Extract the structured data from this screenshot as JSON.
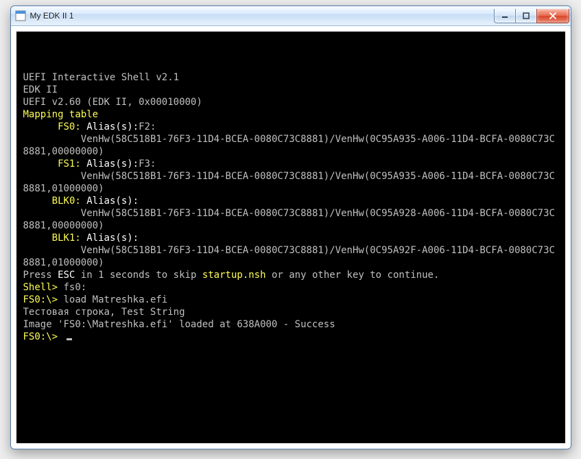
{
  "window": {
    "title": "My EDK II 1"
  },
  "shell": {
    "banner1": "UEFI Interactive Shell v2.1",
    "banner2": "EDK II",
    "banner3": "UEFI v2.60 (EDK II, 0x00010000)",
    "mapping_table": "Mapping table",
    "fs0_label": "FS0:",
    "fs0_alias": " Alias(s):",
    "fs0_alias_val": "F2:",
    "fs0_path": "          VenHw(58C518B1-76F3-11D4-BCEA-0080C73C8881)/VenHw(0C95A935-A006-11D4-BCFA-0080C73C8881,00000000)",
    "fs1_label": "FS1:",
    "fs1_alias": " Alias(s):",
    "fs1_alias_val": "F3:",
    "fs1_path": "          VenHw(58C518B1-76F3-11D4-BCEA-0080C73C8881)/VenHw(0C95A935-A006-11D4-BCFA-0080C73C8881,01000000)",
    "blk0_label": "BLK0:",
    "blk0_alias": " Alias(s):",
    "blk0_path": "          VenHw(58C518B1-76F3-11D4-BCEA-0080C73C8881)/VenHw(0C95A928-A006-11D4-BCFA-0080C73C8881,00000000)",
    "blk1_label": "BLK1:",
    "blk1_alias": " Alias(s):",
    "blk1_path": "          VenHw(58C518B1-76F3-11D4-BCEA-0080C73C8881)/VenHw(0C95A92F-A006-11D4-BCFA-0080C73C8881,01000000)",
    "press_a": "Press ",
    "press_esc": "ESC",
    "press_b": " in 1 seconds to skip ",
    "press_startup": "startup.nsh",
    "press_c": " or any other key to continue.",
    "shell_prompt": "Shell>",
    "shell_cmd": " fs0:",
    "fs0_prompt1": "FS0:\\>",
    "fs0_cmd1": " load Matreshka.efi",
    "test_line": "Тестовая строка, Test String",
    "load_result": "Image 'FS0:\\Matreshka.efi' loaded at 638A000 - Success",
    "fs0_prompt2": "FS0:\\>"
  }
}
